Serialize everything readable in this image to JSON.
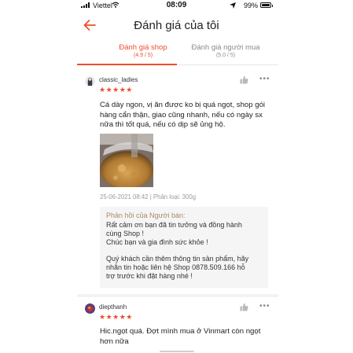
{
  "status_bar": {
    "carrier": "Viettel",
    "time": "08:09",
    "battery": "99%",
    "battery_level": 0.99
  },
  "header": {
    "title": "Đánh giá của tôi"
  },
  "tabs": [
    {
      "label": "Đánh giá shop",
      "score": "(4.9 / 5)",
      "active": true
    },
    {
      "label": "Đánh giá người mua",
      "score": "(5.0 / 5)",
      "active": false
    }
  ],
  "colors": {
    "accent": "#ee4d2d",
    "reply_title": "#a88a6a",
    "muted": "#9a9a9a"
  },
  "reviews": [
    {
      "username": "classic_ladies",
      "stars": "★★★★★",
      "rating": 5,
      "text_lines": [
        "Cá dày ngon, vị ăn được ko bị quá ngọt, shop gói",
        "hàng cẩn thận, giao cũng nhanh, nếu có ngày sx",
        "nữa thì tốt quá, nếu có dịp sẽ ủng hộ."
      ],
      "meta": "25-06-2021 08:42 | Phân loại: 300g",
      "seller_reply": {
        "title": "Phản hồi của Người bán:",
        "lines": [
          "Rất cảm ơn bạn đã tin tưởng và đồng hành",
          "cùng Shop !",
          "Chúc bạn và gia đình sức khỏe !",
          "",
          "Quý khách cần thêm thông tin sản phẩm, hãy",
          "nhắn tin hoặc liên hệ Shop 0878.509.166 hỗ",
          "trợ trước khi đặt hàng nhé !"
        ]
      }
    },
    {
      "username": "diepthanh",
      "stars": "★★★★★",
      "rating": 5,
      "text_lines": [
        "Hic.ngọt quá. Đợt mình mua ở Vinmart còn ngọt",
        "hơn nữa"
      ]
    }
  ],
  "icons": {
    "back": "back-arrow-icon",
    "like": "thumbs-up-icon",
    "more": "more-dots-icon"
  }
}
